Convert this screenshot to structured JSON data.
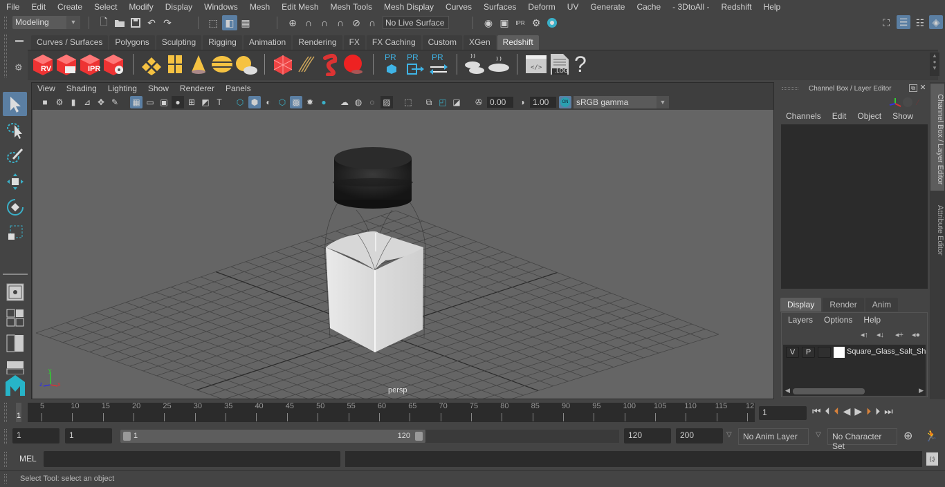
{
  "menubar": {
    "items": [
      "File",
      "Edit",
      "Create",
      "Select",
      "Modify",
      "Display",
      "Windows",
      "Mesh",
      "Edit Mesh",
      "Mesh Tools",
      "Mesh Display",
      "Curves",
      "Surfaces",
      "Deform",
      "UV",
      "Generate",
      "Cache",
      "- 3DtoAll -",
      "Redshift",
      "Help"
    ]
  },
  "statusline": {
    "workspace": "Modeling",
    "live_surface": "No Live Surface",
    "icons": [
      "new-scene-icon",
      "open-scene-icon",
      "save-scene-icon",
      "undo-icon",
      "redo-icon",
      "select-hierarchy-icon",
      "select-object-icon",
      "select-component-icon",
      "snap-grid-icon",
      "snap-curve-icon",
      "snap-point-icon",
      "snap-projected-icon",
      "snap-view-plane-icon",
      "make-live-icon",
      "render-view-icon",
      "render-frame-icon",
      "ipr-render-icon",
      "render-settings-icon",
      "hypershade-icon"
    ]
  },
  "shelf": {
    "tabs": [
      "Curves / Surfaces",
      "Polygons",
      "Sculpting",
      "Rigging",
      "Animation",
      "Rendering",
      "FX",
      "FX Caching",
      "Custom",
      "XGen",
      "Redshift"
    ],
    "active_tab": "Redshift",
    "icon_labels": {
      "rv": "RV",
      "ipr": "IPR",
      "pr1": "PR",
      "pr2": "PR",
      "pr3": "PR",
      "log": ".LOG",
      "help": "?"
    }
  },
  "viewport": {
    "menu": [
      "View",
      "Shading",
      "Lighting",
      "Show",
      "Renderer",
      "Panels"
    ],
    "exposure": "0.00",
    "gamma": "1.00",
    "color_mgmt": "ON",
    "color_space": "sRGB gamma",
    "camera_label": "persp",
    "axis_labels": {
      "x": "x",
      "y": "y",
      "z": "z"
    }
  },
  "right_panel": {
    "title": "Channel Box / Layer Editor",
    "channel_menu": [
      "Channels",
      "Edit",
      "Object",
      "Show"
    ],
    "layer_tabs": [
      "Display",
      "Render",
      "Anim"
    ],
    "active_layer_tab": "Display",
    "layer_menu": [
      "Layers",
      "Options",
      "Help"
    ],
    "layers": [
      {
        "visible": "V",
        "playback": "P",
        "name": "Square_Glass_Salt_Sha",
        "color": "#ffffff"
      }
    ],
    "side_tabs": [
      "Channel Box / Layer Editor",
      "Attribute Editor"
    ]
  },
  "timeline": {
    "start_marker": "1",
    "ticks": [
      "5",
      "10",
      "15",
      "20",
      "25",
      "30",
      "35",
      "40",
      "45",
      "50",
      "55",
      "60",
      "65",
      "70",
      "75",
      "80",
      "85",
      "90",
      "95",
      "100",
      "105",
      "110",
      "115",
      "12"
    ],
    "current_frame": "1"
  },
  "range": {
    "start_time": "1",
    "playback_start": "1",
    "slider_start": "1",
    "slider_end": "120",
    "playback_end": "120",
    "end_time": "200",
    "anim_layer": "No Anim Layer",
    "character_set": "No Character Set"
  },
  "command": {
    "language": "MEL",
    "input": "",
    "output": ""
  },
  "help_line": "Select Tool: select an object"
}
